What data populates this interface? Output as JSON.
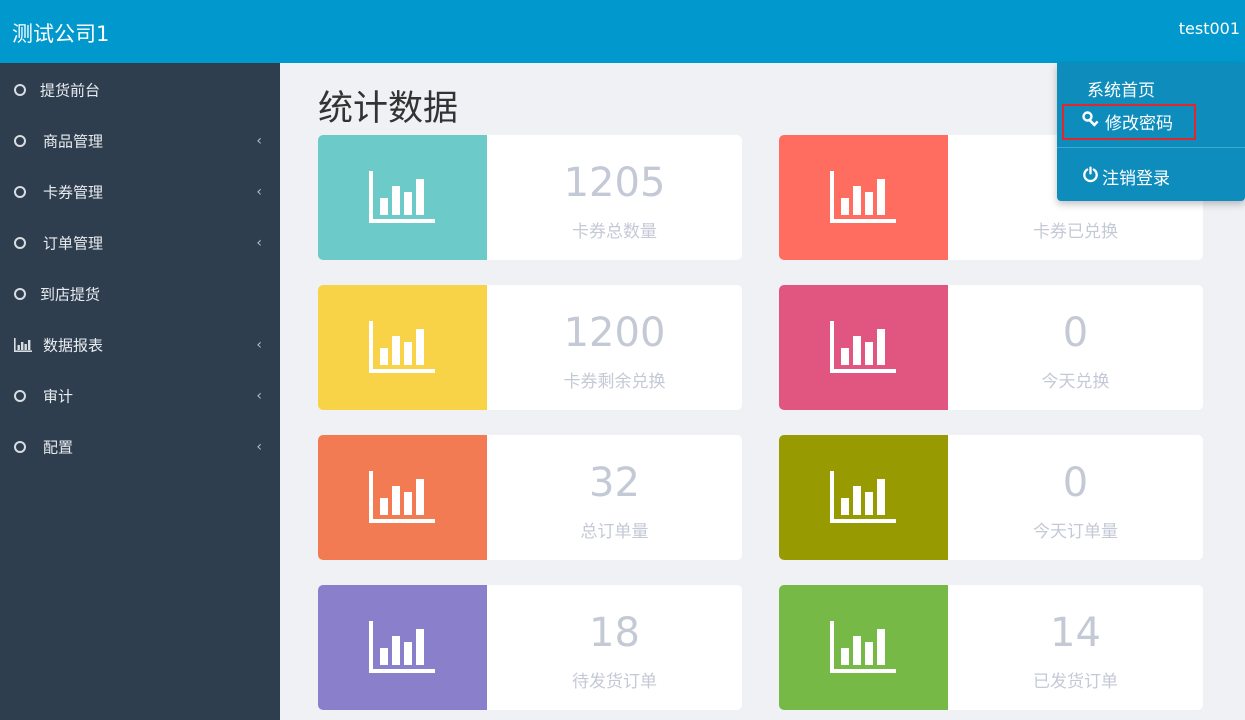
{
  "header": {
    "brand": "测试公司1",
    "user": "test001"
  },
  "sidebar": {
    "items": [
      {
        "label": "提货前台",
        "icon": "circle-icon",
        "has_submenu": false
      },
      {
        "label": "商品管理",
        "icon": "circle-icon",
        "has_submenu": true
      },
      {
        "label": "卡券管理",
        "icon": "circle-icon",
        "has_submenu": true
      },
      {
        "label": "订单管理",
        "icon": "circle-icon",
        "has_submenu": true
      },
      {
        "label": "到店提货",
        "icon": "circle-icon",
        "has_submenu": false
      },
      {
        "label": "数据报表",
        "icon": "bar-chart-icon",
        "has_submenu": true
      },
      {
        "label": "审计",
        "icon": "circle-icon",
        "has_submenu": true
      },
      {
        "label": "配置",
        "icon": "circle-icon",
        "has_submenu": true
      }
    ],
    "chevron": "‹"
  },
  "main": {
    "title": "统计数据",
    "cards": [
      {
        "value": "1205",
        "label": "卡券总数量",
        "color": "#6ccac9"
      },
      {
        "value": "",
        "label": "卡券已兑换",
        "color": "#ff6c60"
      },
      {
        "value": "1200",
        "label": "卡券剩余兑换",
        "color": "#f8d347"
      },
      {
        "value": "0",
        "label": "今天兑换",
        "color": "#e05680"
      },
      {
        "value": "32",
        "label": "总订单量",
        "color": "#f37b53"
      },
      {
        "value": "0",
        "label": "今天订单量",
        "color": "#979a00"
      },
      {
        "value": "18",
        "label": "待发货订单",
        "color": "#8a7fca"
      },
      {
        "value": "14",
        "label": "已发货订单",
        "color": "#76b946"
      }
    ]
  },
  "dropdown": {
    "home": "系统首页",
    "change_password": "修改密码",
    "logout": "注销登录"
  }
}
